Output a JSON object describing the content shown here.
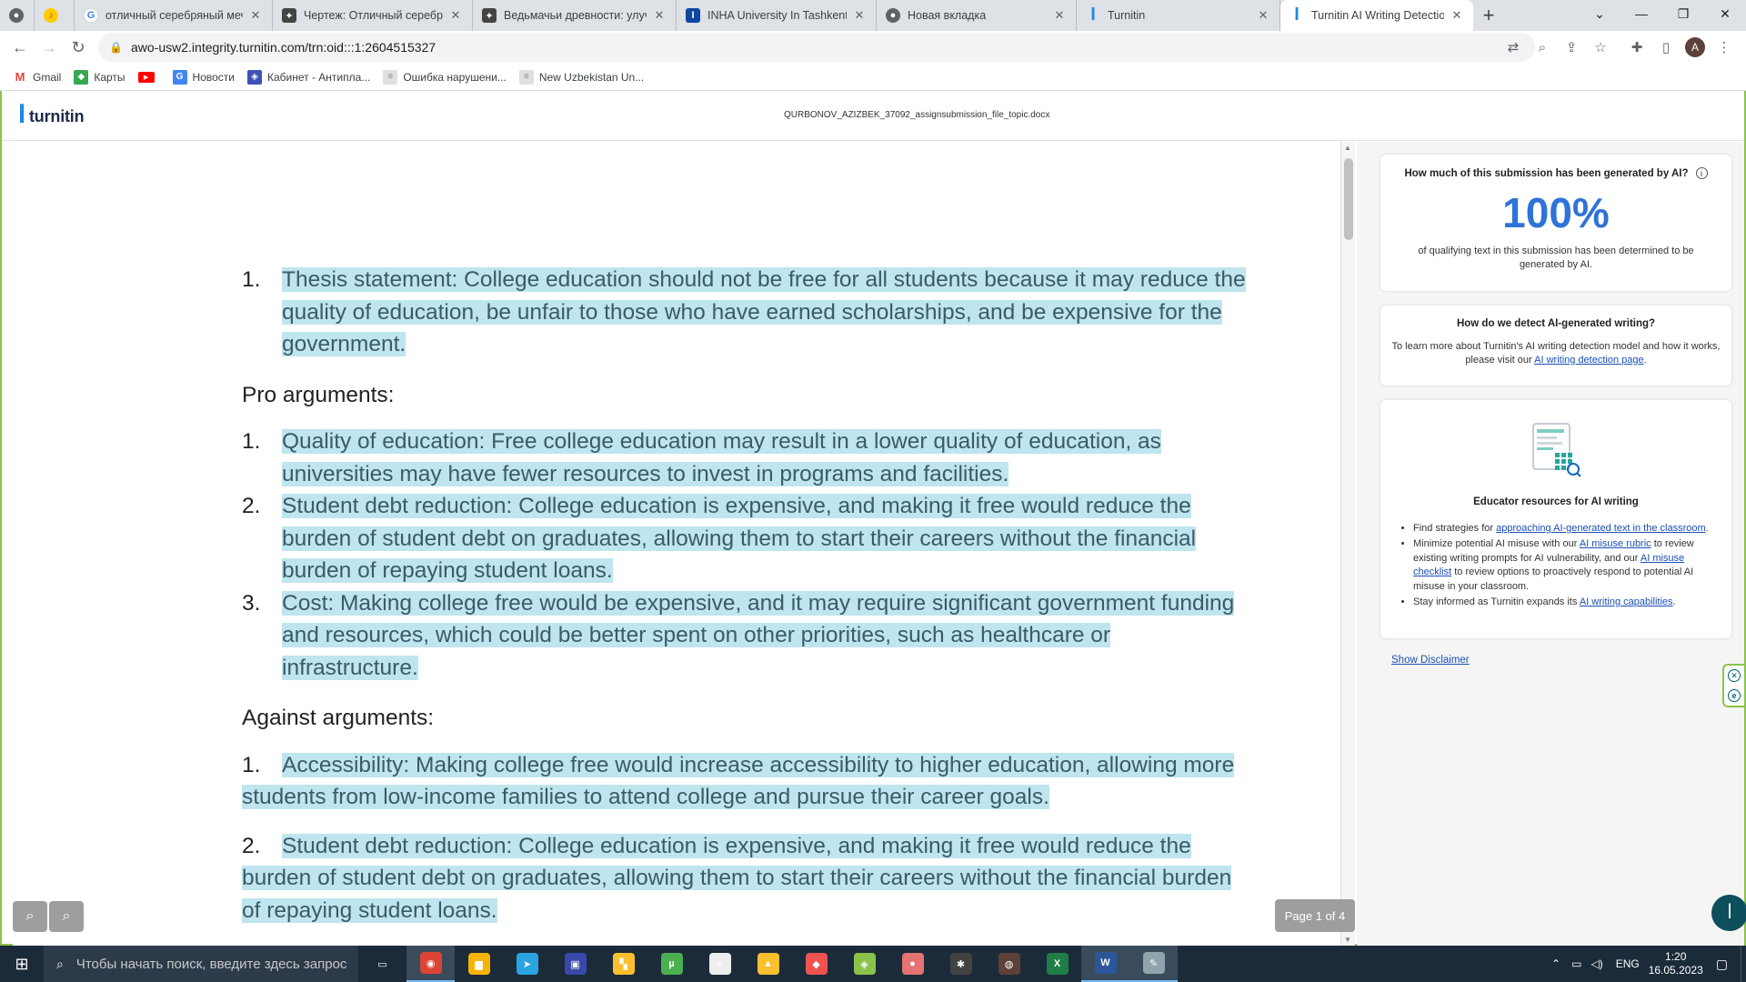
{
  "browser": {
    "tabs": [
      {
        "label": "",
        "icon": "chrome-icon",
        "color": "#5f6368",
        "active": false
      },
      {
        "label": "",
        "icon": "yandex-music-icon",
        "color": "#ffcc00",
        "active": false
      },
      {
        "label": "отличный серебряный меч и",
        "icon": "google-icon",
        "color": "#4285f4",
        "active": false
      },
      {
        "label": "Чертеж: Отличный серебрян",
        "icon": "game-icon",
        "color": "#444444",
        "active": false
      },
      {
        "label": "Ведьмачьи древности: улучш",
        "icon": "game-icon",
        "color": "#444444",
        "active": false
      },
      {
        "label": "INHA University In Tashkent",
        "icon": "inha-icon",
        "color": "#0d47a1",
        "active": false
      },
      {
        "label": "Новая вкладка",
        "icon": "chrome-icon",
        "color": "#5f6368",
        "active": false
      },
      {
        "label": "Turnitin",
        "icon": "turnitin-icon",
        "color": "#1e88e5",
        "active": false
      },
      {
        "label": "Turnitin AI Writing Detection",
        "icon": "turnitin-icon",
        "color": "#1e88e5",
        "active": true
      }
    ],
    "url": "awo-usw2.integrity.turnitin.com/trn:oid:::1:2604515327",
    "avatar_letter": "A",
    "bookmarks": [
      {
        "label": "Gmail",
        "icon": "gmail-icon",
        "color": "#ea4335"
      },
      {
        "label": "Карты",
        "icon": "maps-icon",
        "color": "#34a853"
      },
      {
        "label": "",
        "icon": "youtube-icon",
        "color": "#ff0000"
      },
      {
        "label": "Новости",
        "icon": "news-icon",
        "color": "#4285f4"
      },
      {
        "label": "Кабинет - Антипла...",
        "icon": "shield-icon",
        "color": "#3f51b5"
      },
      {
        "label": "Ошибка нарушени...",
        "icon": "page-icon",
        "color": "#bdbdbd"
      },
      {
        "label": "New Uzbekistan Un...",
        "icon": "page-icon",
        "color": "#bdbdbd"
      }
    ]
  },
  "header": {
    "logo": "turnitin",
    "filename": "QURBONOV_AZIZBEK_37092_assignsubmission_file_topic.docx"
  },
  "document": {
    "thesis": {
      "num": "1.",
      "text": "Thesis statement: College education should not be free for all students because it may reduce the quality of education, be unfair to those who have earned scholarships, and be expensive for the government."
    },
    "pro_heading": "Pro arguments:",
    "pro_items": [
      {
        "num": "1.",
        "text": "Quality of education: Free college education may result in a lower quality of education, as universities may have fewer resources to invest in programs and facilities."
      },
      {
        "num": "2.",
        "text": "Student debt reduction: College education is expensive, and making it free would reduce the burden of student debt on graduates, allowing them to start their careers without the financial burden of repaying student loans."
      },
      {
        "num": "3.",
        "text": "Cost: Making college free would be expensive, and it may require significant government funding and resources, which could be better spent on other priorities, such as healthcare or infrastructure."
      }
    ],
    "against_heading": "Against arguments:",
    "against_items": [
      {
        "num": "1.",
        "text": "Accessibility: Making college free would increase accessibility to higher education, allowing more students from low-income families to attend college and pursue their career goals."
      },
      {
        "num": "2.",
        "text": "Student debt reduction: College education is expensive, and making it free would reduce the burden of student debt on graduates, allowing them to start their careers without the financial burden of repaying student loans."
      }
    ],
    "page_indicator": "Page 1 of 4",
    "highlight_color": "#bfe5ee"
  },
  "panel": {
    "ai_question": "How much of this submission has been generated by AI?",
    "ai_percent": "100%",
    "ai_desc": "of qualifying text in this submission has been determined to be generated by AI.",
    "detect_title": "How do we detect AI-generated writing?",
    "detect_text": "To learn more about Turnitin's AI writing detection model and how it works, please visit our",
    "detect_link": "AI writing detection page",
    "resources_title": "Educator resources for AI writing",
    "res1_pre": "Find strategies for",
    "res1_link": "approaching AI-generated text in the classroom",
    "res2_pre": "Minimize potential AI misuse with our",
    "res2_link1": "AI misuse rubric",
    "res2_mid": "to review existing writing prompts for AI vulnerability, and our",
    "res2_link2": "AI misuse checklist",
    "res2_post": "to review options to proactively respond to potential AI misuse in your classroom.",
    "res3_pre": "Stay informed as Turnitin expands its",
    "res3_link": "AI writing capabilities",
    "disclaimer": "Show Disclaimer",
    "accent_color": "#2f73d8"
  },
  "taskbar": {
    "search_placeholder": "Чтобы начать поиск, введите здесь запрос",
    "lang": "ENG",
    "time": "1:20",
    "date": "16.05.2023",
    "apps": [
      {
        "name": "task-view-icon",
        "color": "#1c2b3a",
        "glyph": "▭"
      },
      {
        "name": "chrome-icon",
        "color": "#db4437",
        "glyph": "◉",
        "active": true
      },
      {
        "name": "file-explorer-icon",
        "color": "#f4b400",
        "glyph": "▆"
      },
      {
        "name": "telegram-icon",
        "color": "#2aa3df",
        "glyph": "➤"
      },
      {
        "name": "save-app-icon",
        "color": "#3949ab",
        "glyph": "▣"
      },
      {
        "name": "puzzle-app-icon",
        "color": "#fbc02d",
        "glyph": "▚"
      },
      {
        "name": "utorrent-icon",
        "color": "#4caf50",
        "glyph": "µ"
      },
      {
        "name": "rfid-app-icon",
        "color": "#eeeeee",
        "glyph": "≡"
      },
      {
        "name": "warning-app-icon",
        "color": "#fbc02d",
        "glyph": "▲"
      },
      {
        "name": "anydesk-icon",
        "color": "#ef5350",
        "glyph": "◆"
      },
      {
        "name": "bluestacks-icon",
        "color": "#8bc34a",
        "glyph": "◈"
      },
      {
        "name": "game-app-icon",
        "color": "#e57373",
        "glyph": "●"
      },
      {
        "name": "spider-app-icon",
        "color": "#424242",
        "glyph": "✱"
      },
      {
        "name": "witcher-icon",
        "color": "#5d4037",
        "glyph": "◍"
      },
      {
        "name": "excel-icon",
        "color": "#1e7e45",
        "glyph": "X"
      },
      {
        "name": "word-icon",
        "color": "#2b579a",
        "glyph": "W",
        "active": true
      },
      {
        "name": "paint-icon",
        "color": "#90a4ae",
        "glyph": "✎",
        "active": true
      }
    ]
  }
}
